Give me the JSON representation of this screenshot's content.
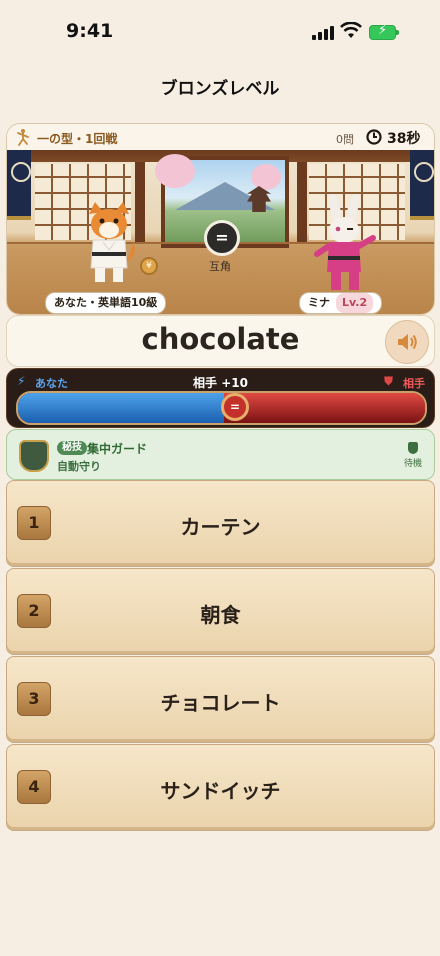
{
  "status_bar": {
    "time": "9:41"
  },
  "header": {
    "title": "ブロンズレベル"
  },
  "battle": {
    "round_label": "一の型・1回戦",
    "question_count": "0問",
    "timer": "38秒",
    "center_label": "互角",
    "center_symbol": "=",
    "player_tag": "あなた・英単語10級",
    "opponent_name": "ミナ",
    "opponent_level": "Lv.2"
  },
  "word": {
    "text": "chocolate"
  },
  "power_bar": {
    "left_label": "あなた",
    "center_label": "相手 +10",
    "right_label": "相手",
    "player_share": 0.505,
    "knob_symbol": "=",
    "colors": {
      "player": "#2f7fd0",
      "opponent": "#c62f2a"
    }
  },
  "skill": {
    "badge": "秘技",
    "name": "集中ガード",
    "sub": "自動守り",
    "status": "待機"
  },
  "options": [
    {
      "number": "1",
      "label": "カーテン"
    },
    {
      "number": "2",
      "label": "朝食"
    },
    {
      "number": "3",
      "label": "チョコレート"
    },
    {
      "number": "4",
      "label": "サンドイッチ"
    }
  ]
}
